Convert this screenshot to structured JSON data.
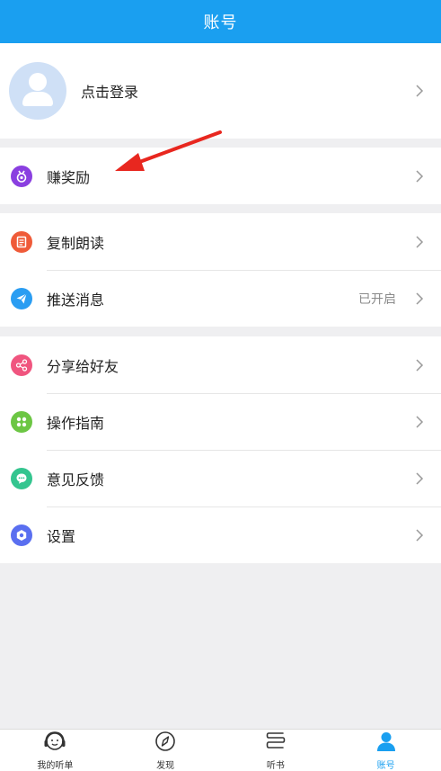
{
  "header": {
    "title": "账号"
  },
  "profile": {
    "label": "点击登录"
  },
  "groups": [
    {
      "items": [
        {
          "label": "赚奖励",
          "icon": "medal-icon",
          "color": "#8a3fe0"
        }
      ]
    },
    {
      "items": [
        {
          "label": "复制朗读",
          "icon": "document-icon",
          "color": "#ef5b39"
        },
        {
          "label": "推送消息",
          "icon": "paper-plane-icon",
          "color": "#2a9df2",
          "value": "已开启"
        }
      ]
    },
    {
      "items": [
        {
          "label": "分享给好友",
          "icon": "share-icon",
          "color": "#f0557f"
        },
        {
          "label": "操作指南",
          "icon": "grid-icon",
          "color": "#6cc644"
        },
        {
          "label": "意见反馈",
          "icon": "chat-icon",
          "color": "#34c58f"
        },
        {
          "label": "设置",
          "icon": "settings-icon",
          "color": "#5a6ff0"
        }
      ]
    }
  ],
  "tabbar": {
    "tabs": [
      {
        "label": "我的听单",
        "icon": "headphone-face-icon"
      },
      {
        "label": "发现",
        "icon": "compass-icon"
      },
      {
        "label": "听书",
        "icon": "book-icon"
      },
      {
        "label": "账号",
        "icon": "user-icon",
        "active": true
      }
    ]
  },
  "colors": {
    "primary": "#1a9ff0",
    "annotation_arrow": "#e8271f"
  }
}
